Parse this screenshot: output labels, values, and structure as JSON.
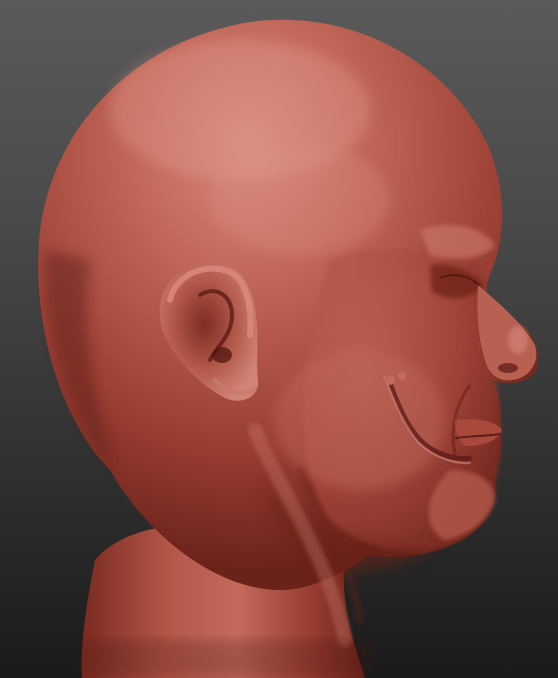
{
  "scene": {
    "subject": "sculpted-head-profile",
    "colors": {
      "background_top": "#5a5a5a",
      "background_bottom": "#1a1a1a",
      "clay_base": "#a8463a",
      "clay_highlight": "#d2867a",
      "clay_shadow": "#5a1a14",
      "clay_mid": "#b55a4c"
    }
  }
}
